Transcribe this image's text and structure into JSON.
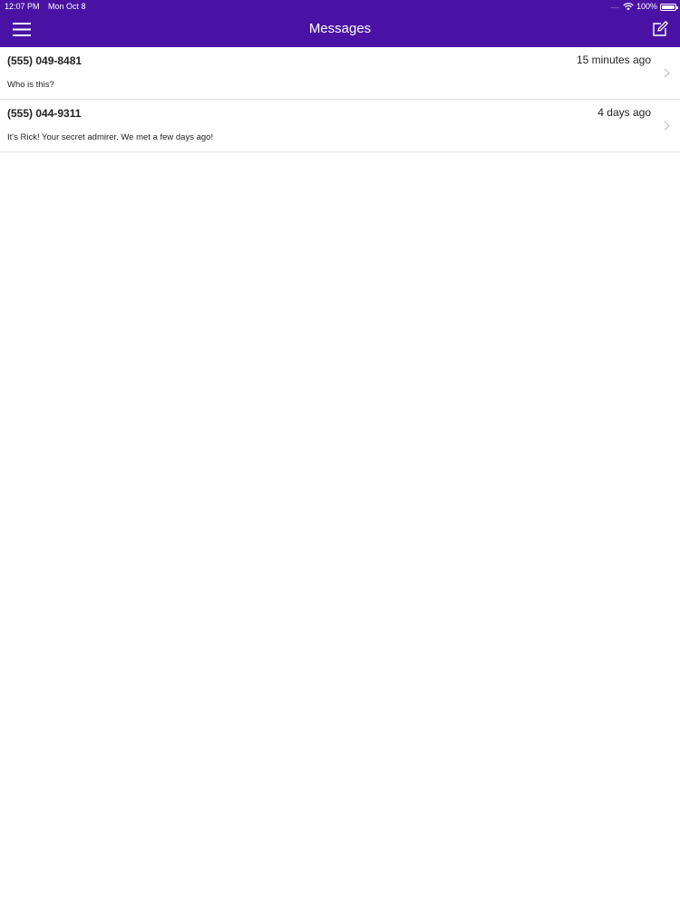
{
  "status_bar": {
    "time": "12:07 PM",
    "date": "Mon Oct 8",
    "signal": ".....",
    "battery": "100%",
    "icons": [
      "wifi-icon",
      "battery-icon"
    ]
  },
  "nav": {
    "title": "Messages",
    "left_icon": "hamburger-menu-icon",
    "right_icon": "compose-icon"
  },
  "colors": {
    "accent": "#4a12a4",
    "background": "#ffffff",
    "divider": "#e2e2e2",
    "chevron": "#c7c7cc"
  },
  "messages": [
    {
      "sender": "(555) 049-8481",
      "time": "15 minutes ago",
      "preview": "Who is this?"
    },
    {
      "sender": "(555) 044-9311",
      "time": "4 days ago",
      "preview": "It's Rick! Your secret admirer. We met a few days ago!"
    }
  ]
}
